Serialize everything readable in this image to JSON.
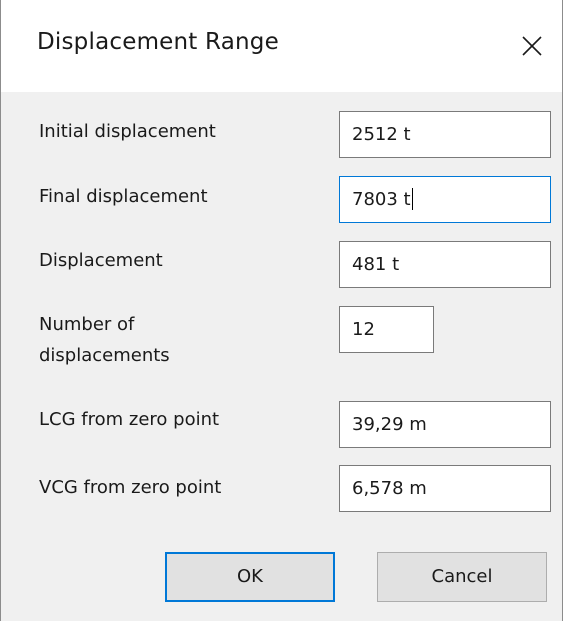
{
  "dialog": {
    "title": "Displacement Range",
    "close_icon": "close-icon"
  },
  "fields": {
    "initial_displacement": {
      "label": "Initial displacement",
      "value": "2512 t"
    },
    "final_displacement": {
      "label": "Final displacement",
      "value": "7803 t"
    },
    "displacement_increment": {
      "label": "Displacement",
      "value": "481 t"
    },
    "number_of_displacements": {
      "label_line1": "Number of",
      "label_line2": "displacements",
      "value": "12"
    },
    "lcg": {
      "label": "LCG from zero point",
      "value": "39,29 m"
    },
    "vcg": {
      "label": "VCG from zero point",
      "value": "6,578 m"
    }
  },
  "buttons": {
    "ok": "OK",
    "cancel": "Cancel"
  },
  "colors": {
    "focus_border": "#0078d7",
    "dialog_bg": "#f0f0f0",
    "button_bg": "#e1e1e1"
  }
}
